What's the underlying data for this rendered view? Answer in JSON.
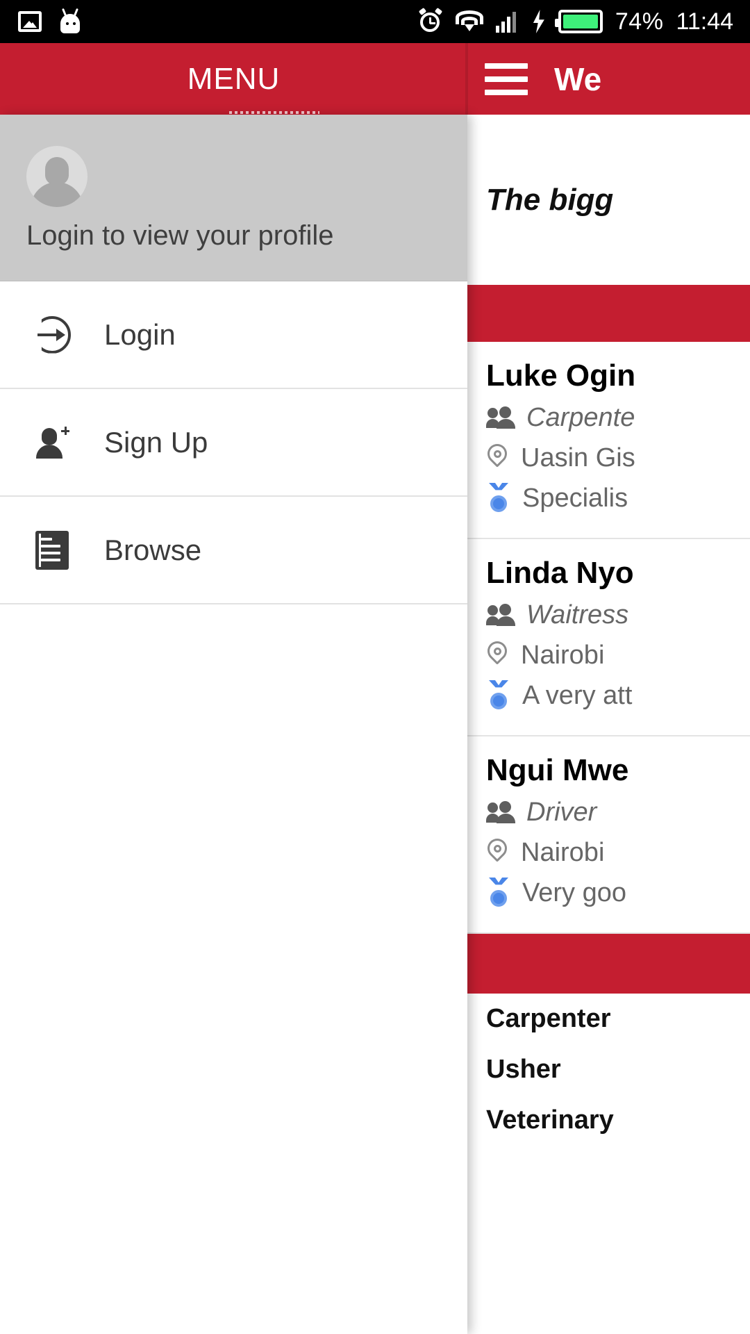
{
  "status_bar": {
    "battery_percent": "74%",
    "time": "11:44",
    "icons": [
      "screenshot-image-icon",
      "android-robot-icon",
      "alarm-icon",
      "wifi-icon",
      "cellular-signal-icon",
      "charging-bolt-icon",
      "battery-icon"
    ]
  },
  "app_bar": {
    "drawer_title": "MENU",
    "menu_icon": "hamburger-icon",
    "main_title": "We"
  },
  "drawer": {
    "profile": {
      "avatar_icon": "default-avatar-icon",
      "label": "Login to view your profile"
    },
    "items": [
      {
        "label": "Login",
        "icon": "sign-in-icon"
      },
      {
        "label": "Sign Up",
        "icon": "person-add-icon"
      },
      {
        "label": "Browse",
        "icon": "document-list-icon"
      }
    ]
  },
  "main": {
    "tagline": "The bigg",
    "workers": [
      {
        "name": "Luke Ogin",
        "occupation": "Carpente",
        "location": "Uasin Gis",
        "review": "Specialis",
        "occupation_icon": "people-icon",
        "location_icon": "location-pin-icon",
        "review_icon": "medal-icon"
      },
      {
        "name": "Linda Nyo",
        "occupation": "Waitress",
        "location": "Nairobi",
        "review": "A very att",
        "occupation_icon": "people-icon",
        "location_icon": "location-pin-icon",
        "review_icon": "medal-icon"
      },
      {
        "name": "Ngui Mwe",
        "occupation": "Driver",
        "location": "Nairobi",
        "review": "Very goo",
        "occupation_icon": "people-icon",
        "location_icon": "location-pin-icon",
        "review_icon": "medal-icon"
      }
    ],
    "categories": [
      "Carpenter",
      "Usher",
      "Veterinary"
    ]
  },
  "colors": {
    "brand_red": "#C41E30",
    "status_bar_bg": "#000000",
    "profile_bg": "#C9C9C9",
    "medal_blue": "#4A86E8",
    "battery_green": "#3EF07A"
  }
}
